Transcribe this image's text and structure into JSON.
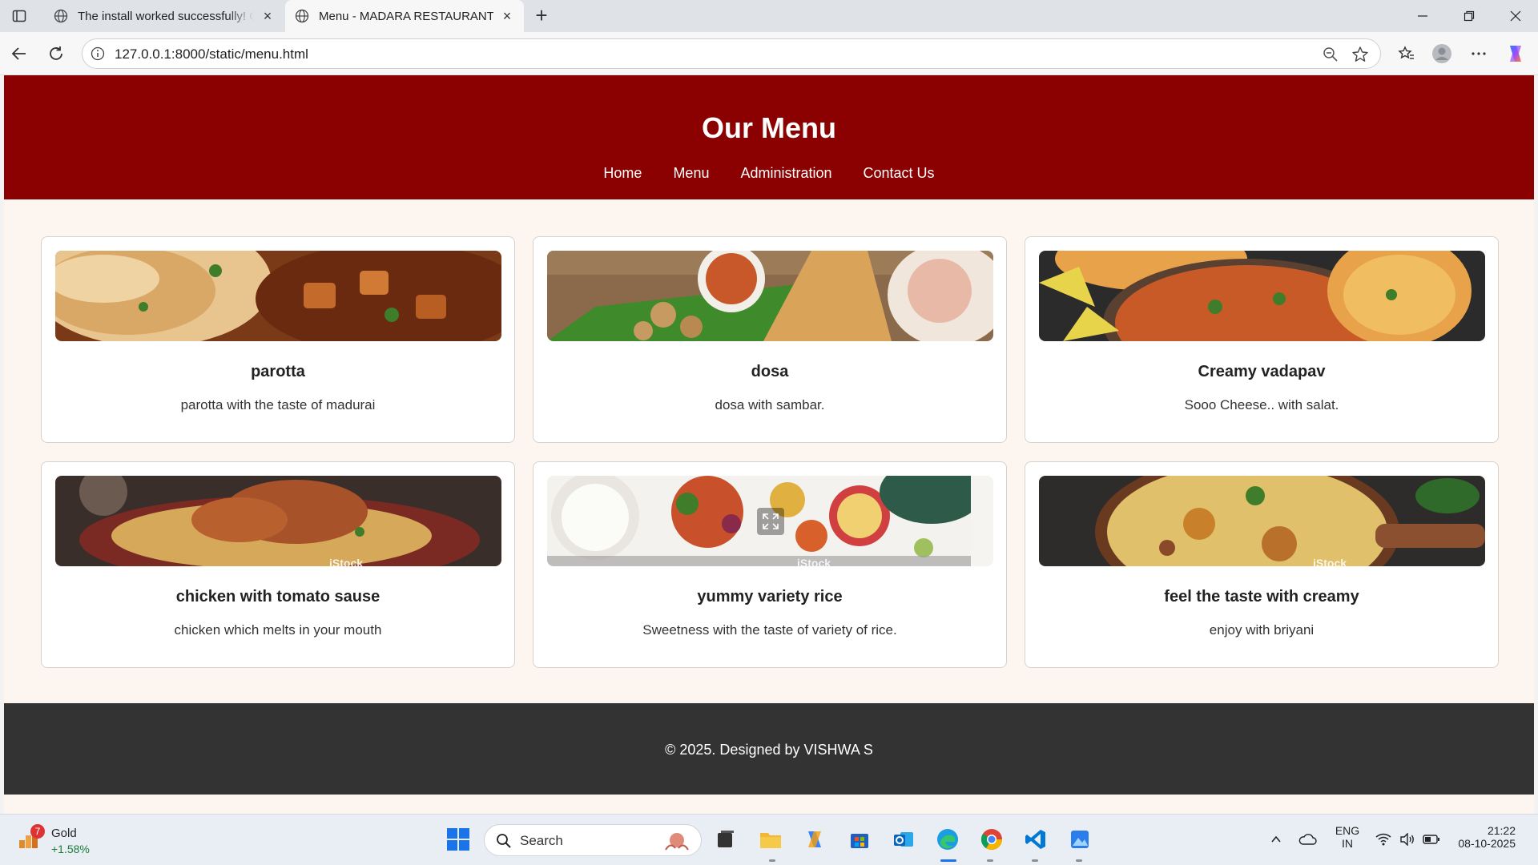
{
  "browser": {
    "tabs": [
      {
        "title": "The install worked successfully! Congratulations!",
        "active": false
      },
      {
        "title": "Menu - MADARA RESTAURANTS",
        "active": true
      }
    ],
    "url": "127.0.0.1:8000/static/menu.html"
  },
  "site": {
    "title": "Our Menu",
    "nav": [
      "Home",
      "Menu",
      "Administration",
      "Contact Us"
    ],
    "items": [
      {
        "name": "parotta",
        "description": "parotta with the taste of madurai"
      },
      {
        "name": "dosa",
        "description": "dosa with sambar."
      },
      {
        "name": "Creamy vadapav",
        "description": "Sooo Cheese.. with salat."
      },
      {
        "name": "chicken with tomato sause",
        "description": "chicken which melts in your mouth",
        "watermark": "iStock"
      },
      {
        "name": "yummy variety rice",
        "description": "Sweetness with the taste of variety of rice.",
        "watermark": "iStock"
      },
      {
        "name": "feel the taste with creamy",
        "description": "enjoy with briyani",
        "watermark": "iStock"
      }
    ],
    "footer": "© 2025. Designed by VISHWA S"
  },
  "taskbar": {
    "widget": {
      "badge": "7",
      "name": "Gold",
      "change": "+1.58%"
    },
    "search_placeholder": "Search",
    "language": [
      "ENG",
      "IN"
    ],
    "time": "21:22",
    "date": "08-10-2025"
  },
  "colors": {
    "header": "#8b0000",
    "footer": "#333333",
    "page_bg": "#fdf5f0"
  }
}
